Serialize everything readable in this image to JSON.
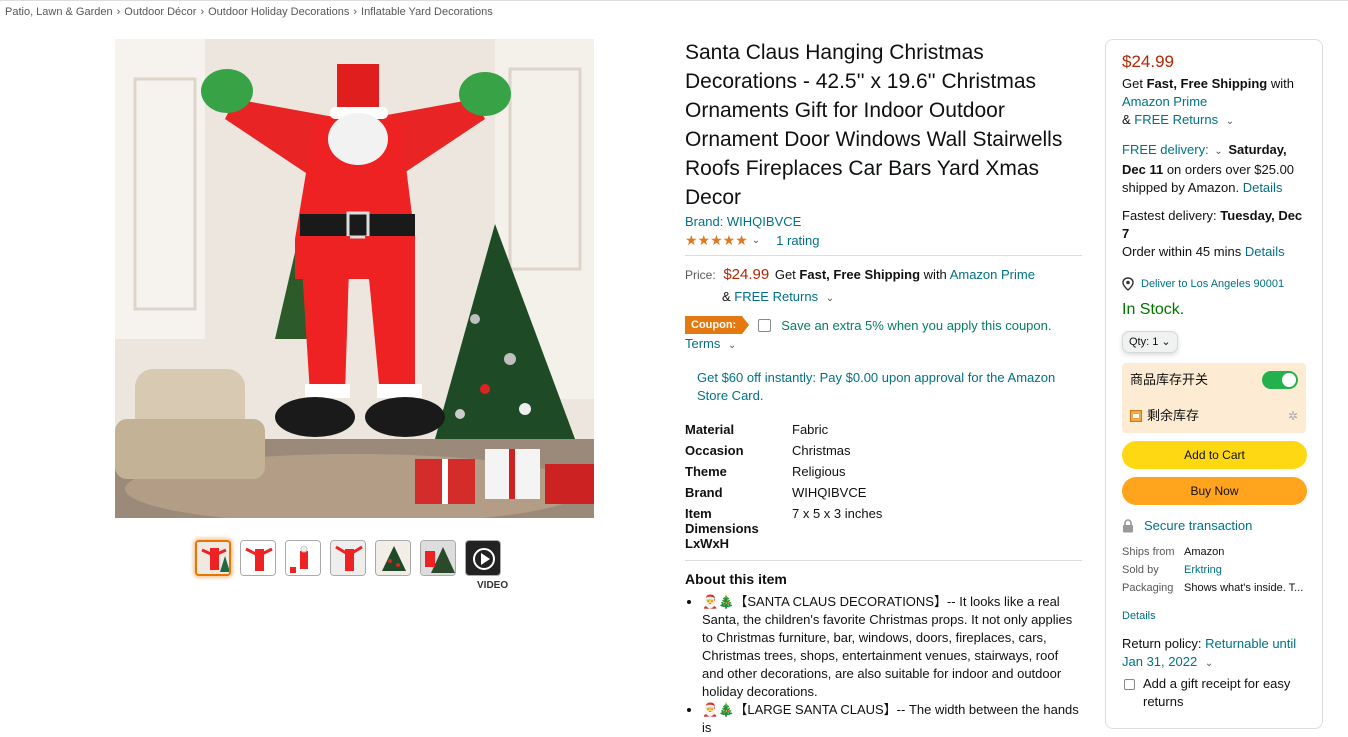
{
  "breadcrumb": [
    "Patio, Lawn & Garden",
    "Outdoor Décor",
    "Outdoor Holiday Decorations",
    "Inflatable Yard Decorations"
  ],
  "gallery": {
    "thumbnail_count": 7,
    "active_thumbnail": 0,
    "video_label": "VIDEO"
  },
  "product": {
    "title": "Santa Claus Hanging Christmas Decorations - 42.5'' x 19.6'' Christmas Ornaments Gift for Indoor Outdoor Ornament Door Windows Wall Stairwells Roofs Fireplaces Car Bars Yard Xmas Decor",
    "brand_link": "Brand: WIHQIBVCE",
    "rating_stars": 5,
    "rating_count": "1 rating",
    "price_label": "Price:",
    "price": "$24.99",
    "shipping_prefix": "Get",
    "shipping_bold": "Fast, Free Shipping",
    "shipping_with": "with",
    "prime_link": "Amazon Prime",
    "returns_amp": "&",
    "free_returns": "FREE Returns",
    "coupon_badge": "Coupon:",
    "coupon_text": "Save an extra 5% when you apply this coupon.",
    "terms": "Terms",
    "card_offer": "Get $60 off instantly: Pay $0.00 upon approval for the Amazon Store Card.",
    "specs": [
      {
        "key": "Material",
        "value": "Fabric"
      },
      {
        "key": "Occasion",
        "value": "Christmas"
      },
      {
        "key": "Theme",
        "value": "Religious"
      },
      {
        "key": "Brand",
        "value": "WIHQIBVCE"
      },
      {
        "key": "Item Dimensions LxWxH",
        "value": "7 x 5 x 3 inches"
      }
    ],
    "about_title": "About this item",
    "about": [
      "🎅🎄【SANTA CLAUS DECORATIONS】-- It looks like a real Santa, the children's favorite Christmas props. It not only applies to Christmas furniture, bar, windows, doors, fireplaces, cars, Christmas trees, shops, entertainment venues, stairways, roof and other decorations, are also suitable for indoor and outdoor holiday decorations.",
      "🎅🎄【LARGE SANTA CLAUS】-- The width between the hands is"
    ]
  },
  "buybox": {
    "price": "$24.99",
    "ship_get": "Get",
    "ship_bold": "Fast, Free Shipping",
    "ship_with": "with",
    "prime_link": "Amazon Prime",
    "returns_amp": "&",
    "free_returns": "FREE Returns",
    "free_delivery_link": "FREE delivery:",
    "delivery_date": "Saturday, Dec 11",
    "delivery_suffix": "on orders over $25.00 shipped by Amazon.",
    "details_link": "Details",
    "fastest_label": "Fastest delivery:",
    "fastest_date": "Tuesday, Dec 7",
    "order_within": "Order within 45 mins",
    "deliver_to": "Deliver to Los Angeles 90001",
    "in_stock": "In Stock.",
    "qty": "Qty: 1",
    "ext_toggle_label": "商品库存开关",
    "ext_stock_label": "剩余库存",
    "add_to_cart": "Add to Cart",
    "buy_now": "Buy Now",
    "secure": "Secure transaction",
    "ships_from_label": "Ships from",
    "ships_from": "Amazon",
    "sold_by_label": "Sold by",
    "sold_by": "Erktring",
    "packaging_label": "Packaging",
    "packaging": "Shows what's inside. T...",
    "extra_details": "Details",
    "return_label": "Return policy:",
    "return_link": "Returnable until Jan 31, 2022",
    "gift_receipt": "Add a gift receipt for easy returns"
  },
  "colors": {
    "accent_price": "#b12704",
    "link": "#007185",
    "in_stock": "#007600",
    "cart": "#ffd814",
    "buy": "#ffa41c",
    "coupon": "#e47911"
  }
}
